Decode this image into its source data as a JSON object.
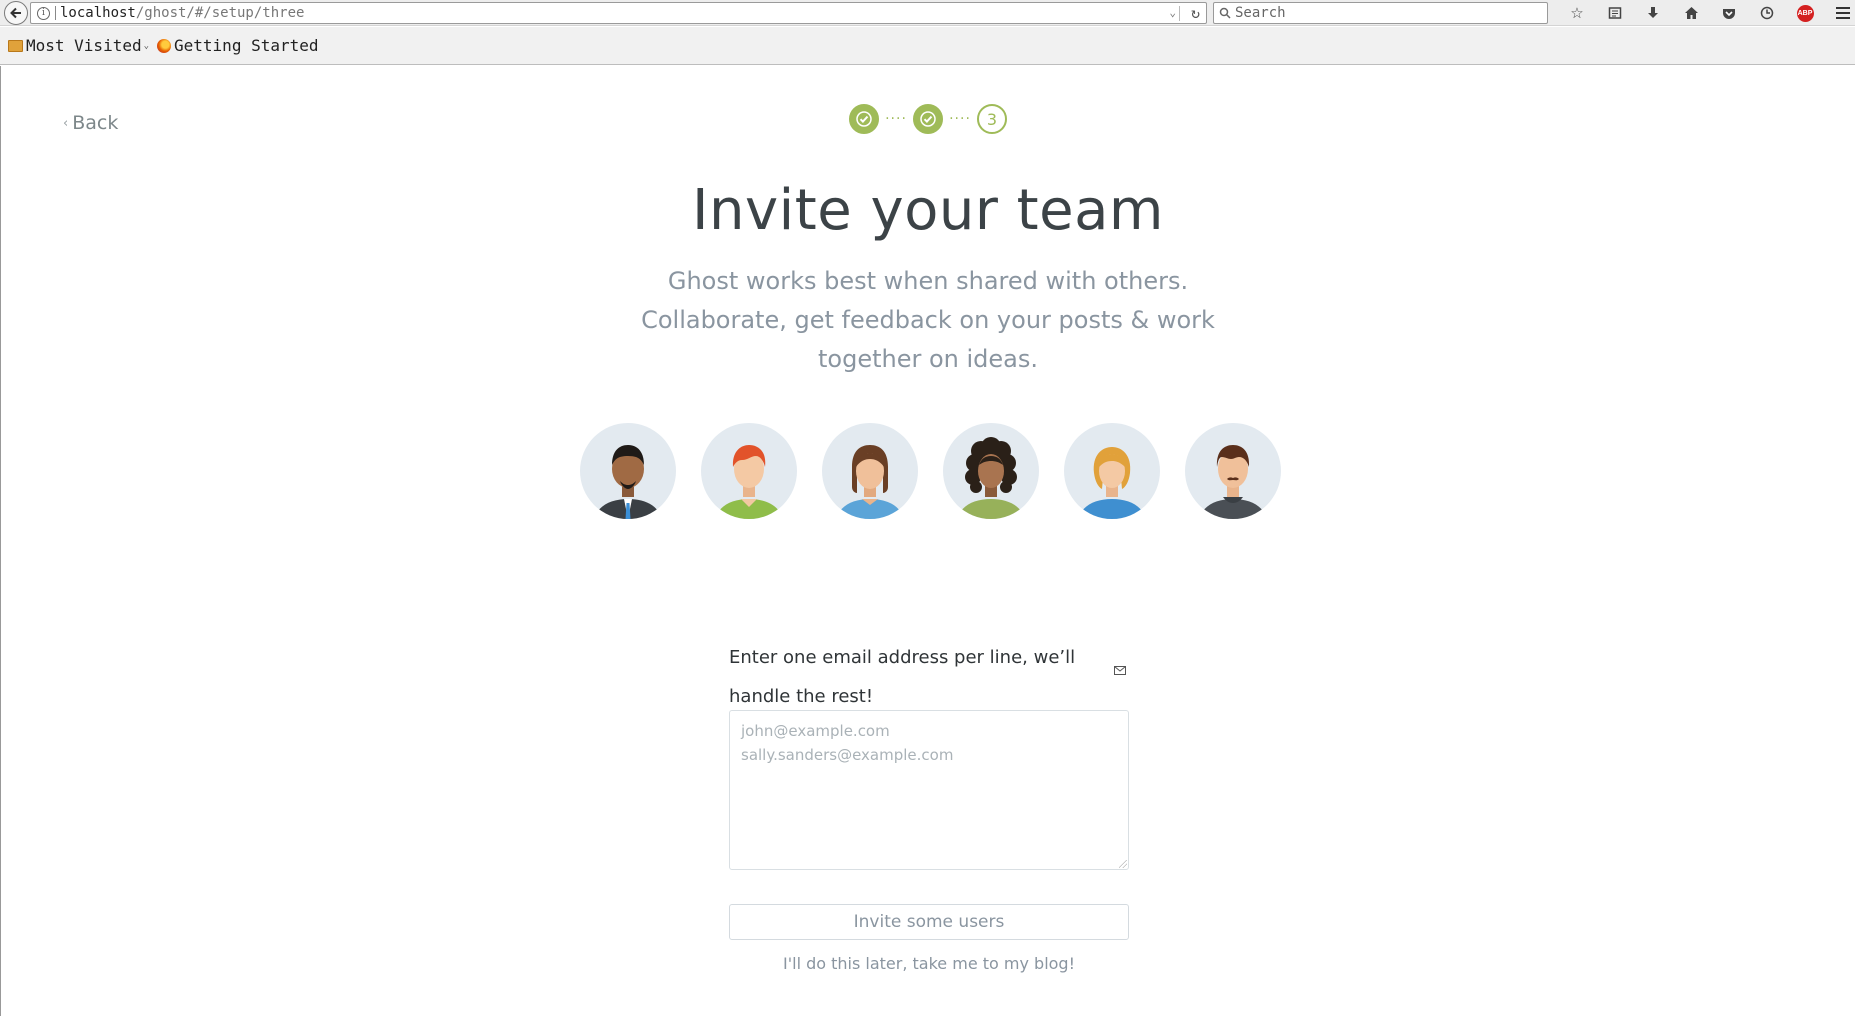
{
  "browser": {
    "url_host": "localhost",
    "url_path": "/ghost/#/setup/three",
    "search_placeholder": "Search",
    "bookmarks": [
      {
        "label": "Most Visited"
      },
      {
        "label": "Getting Started"
      }
    ],
    "abp_label": "ABP"
  },
  "setup": {
    "back_label": "Back",
    "current_step": "3",
    "title": "Invite your team",
    "subtitle": "Ghost works best when shared with others. Collaborate, get feedback on your posts & work together on ideas.",
    "form_label": "Enter one email address per line, we’ll handle the rest!",
    "emails_placeholder": "john@example.com\nsally.sanders@example.com",
    "invite_button": "Invite some users",
    "skip_link": "I'll do this later, take me to my blog!",
    "accent_color": "#9fbb58"
  }
}
